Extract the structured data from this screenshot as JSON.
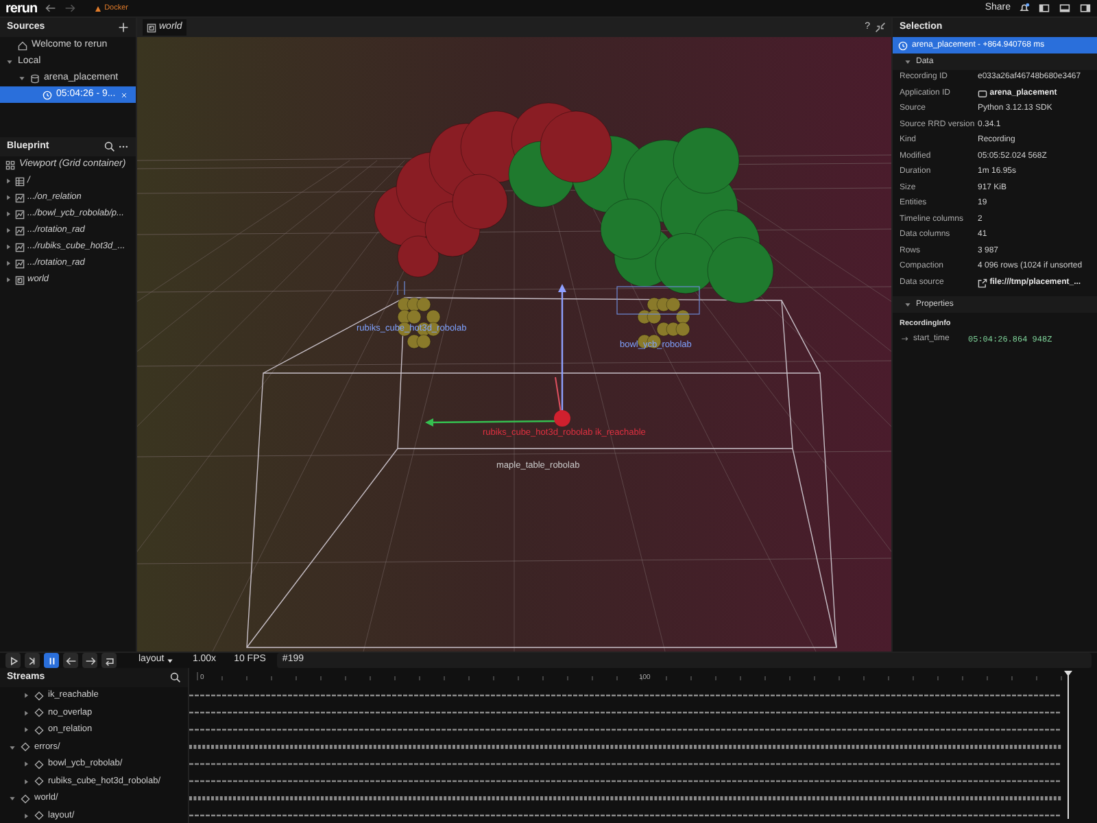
{
  "top_bar": {
    "app_name": "rerun",
    "badge": "Docker",
    "share": "Share"
  },
  "sources": {
    "title": "Sources",
    "items": [
      {
        "label": "Welcome to rerun",
        "kind": "home",
        "selected": false
      },
      {
        "label": "Local",
        "kind": "group",
        "expanded": true,
        "selected": false,
        "children": [
          {
            "label": "arena_placement",
            "kind": "app",
            "expanded": true,
            "selected": false,
            "children": [
              {
                "label": "05:04:26 - 9...",
                "kind": "recording",
                "selected": true
              }
            ]
          }
        ]
      }
    ]
  },
  "blueprint": {
    "title": "Blueprint",
    "root": "Viewport (Grid container)",
    "items": [
      {
        "label": "/",
        "kind": "table"
      },
      {
        "label": ".../on_relation",
        "kind": "chart"
      },
      {
        "label": ".../bowl_ycb_robolab/p...",
        "kind": "chart"
      },
      {
        "label": ".../rotation_rad",
        "kind": "chart"
      },
      {
        "label": ".../rubiks_cube_hot3d_...",
        "kind": "chart"
      },
      {
        "label": ".../rotation_rad",
        "kind": "chart"
      },
      {
        "label": "world",
        "kind": "spatial"
      }
    ]
  },
  "viewport": {
    "tab": "world",
    "help": "?",
    "labels": [
      {
        "text": "rubiks_cube_hot3d_robolab",
        "kind": "blue"
      },
      {
        "text": "bowl_ycb_robolab",
        "kind": "blue"
      },
      {
        "text": "rubiks_cube_hot3d_robolab ik_reachable",
        "kind": "red"
      },
      {
        "text": "maple_table_robolab",
        "kind": "grey"
      }
    ]
  },
  "selection": {
    "title": "Selection",
    "header": "arena_placement - +864.940768 ms",
    "data_title": "Data",
    "rows": [
      {
        "key": "Recording ID",
        "value": "e033a26af46748b680e3467"
      },
      {
        "key": "Application ID",
        "value": "arena_placement",
        "kind": "app"
      },
      {
        "key": "Source",
        "value": "Python 3.12.13 SDK"
      },
      {
        "key": "Source RRD version",
        "value": "0.34.1"
      },
      {
        "key": "Kind",
        "value": "Recording"
      },
      {
        "key": "Modified",
        "value": "05:05:52.024 568Z"
      },
      {
        "key": "Duration",
        "value": "1m 16.95s"
      },
      {
        "key": "Size",
        "value": "917 KiB"
      },
      {
        "key": "Entities",
        "value": "19"
      },
      {
        "key": "Timeline columns",
        "value": "2"
      },
      {
        "key": "Data columns",
        "value": "41"
      },
      {
        "key": "Rows",
        "value": "3 987"
      },
      {
        "key": "Compaction",
        "value": "4 096 rows (1024 if unsorted"
      },
      {
        "key": "Data source",
        "value": "file:///tmp/placement_...",
        "kind": "link"
      }
    ],
    "properties_title": "Properties",
    "group": "RecordingInfo",
    "property": {
      "key": "start_time",
      "value": "05:04:26.864 948Z"
    }
  },
  "timeline": {
    "controls": [
      {
        "kind": "play",
        "selected": false
      },
      {
        "kind": "step",
        "selected": false
      },
      {
        "kind": "pause",
        "selected": true
      },
      {
        "kind": "prev",
        "selected": false
      },
      {
        "kind": "next",
        "selected": false
      },
      {
        "kind": "loop",
        "selected": false
      }
    ],
    "timeline_name": "layout",
    "speed": "1.00x",
    "fps": "10 FPS",
    "frame": "#199",
    "ticks": [
      "0",
      "100"
    ],
    "streams_title": "Streams",
    "streams": [
      {
        "children": [
          {
            "label": "ik_reachable",
            "expanded": false
          },
          {
            "label": "no_overlap",
            "expanded": false
          },
          {
            "label": "on_relation",
            "expanded": false
          }
        ]
      },
      {
        "label": "errors/",
        "expanded": true,
        "children": [
          {
            "label": "bowl_ycb_robolab/",
            "expanded": false
          },
          {
            "label": "rubiks_cube_hot3d_robolab/",
            "expanded": false
          }
        ]
      },
      {
        "label": "world/",
        "expanded": true,
        "children": [
          {
            "label": "layout/",
            "expanded": false
          }
        ]
      }
    ]
  }
}
